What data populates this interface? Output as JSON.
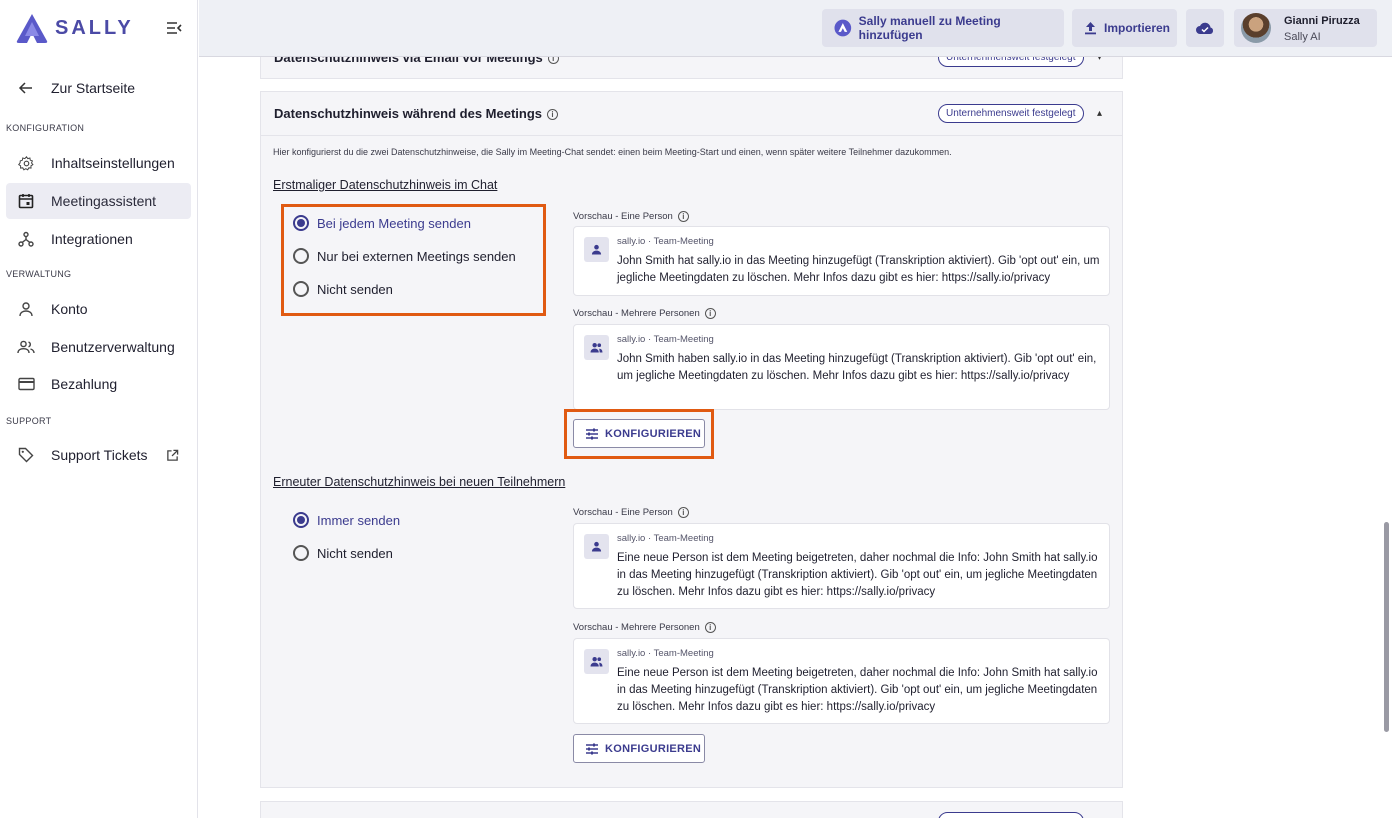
{
  "app": {
    "brand": "SALLY"
  },
  "sidebar": {
    "back_label": "Zur Startseite",
    "sections": {
      "config": "KONFIGURATION",
      "admin": "VERWALTUNG",
      "support": "SUPPORT"
    },
    "items": [
      {
        "label": "Inhaltseinstellungen",
        "icon": "gear-icon",
        "active": false
      },
      {
        "label": "Meetingassistent",
        "icon": "calendar-icon",
        "active": true
      },
      {
        "label": "Integrationen",
        "icon": "integration-icon",
        "active": false
      },
      {
        "label": "Konto",
        "icon": "person-icon",
        "active": false
      },
      {
        "label": "Benutzerverwaltung",
        "icon": "people-icon",
        "active": false
      },
      {
        "label": "Bezahlung",
        "icon": "credit-card-icon",
        "active": false
      },
      {
        "label": "Support Tickets",
        "icon": "tag-icon",
        "active": false
      }
    ]
  },
  "topbar": {
    "add_sally_label": "Sally manuell zu Meeting hinzufügen",
    "import_label": "Importieren",
    "user": {
      "name": "Gianni Piruzza",
      "role": "Sally AI"
    }
  },
  "main": {
    "panel_top": {
      "title": "Datenschutzhinweis via Email vor Meetings",
      "badge": "Unternehmensweit festgelegt"
    },
    "panel": {
      "title": "Datenschutzhinweis während des Meetings",
      "badge": "Unternehmensweit festgelegt",
      "description": "Hier konfigurierst du die zwei Datenschutzhinweise, die Sally im Meeting-Chat sendet: einen beim Meeting-Start und einen, wenn später weitere Teilnehmer dazukommen.",
      "first": {
        "title": "Erstmaliger Datenschutzhinweis im Chat",
        "options": [
          {
            "label": "Bei jedem Meeting senden",
            "selected": true
          },
          {
            "label": "Nur bei externen Meetings senden",
            "selected": false
          },
          {
            "label": "Nicht senden",
            "selected": false
          }
        ],
        "preview_single_label": "Vorschau - Eine Person",
        "preview_single": {
          "meta": "sally.io · Team-Meeting",
          "text": "John Smith hat sally.io in das Meeting hinzugefügt (Transkription aktiviert). Gib 'opt out' ein, um jegliche Meetingdaten zu löschen. Mehr Infos dazu gibt es hier: https://sally.io/privacy"
        },
        "preview_multi_label": "Vorschau - Mehrere Personen",
        "preview_multi": {
          "meta": "sally.io · Team-Meeting",
          "text": "John Smith haben sally.io in das Meeting hinzugefügt (Transkription aktiviert). Gib 'opt out' ein, um jegliche Meetingdaten zu löschen. Mehr Infos dazu gibt es hier: https://sally.io/privacy"
        },
        "configure_label": "KONFIGURIEREN"
      },
      "second": {
        "title": "Erneuter Datenschutzhinweis bei neuen Teilnehmern",
        "options": [
          {
            "label": "Immer senden",
            "selected": true
          },
          {
            "label": "Nicht senden",
            "selected": false
          }
        ],
        "preview_single_label": "Vorschau - Eine Person",
        "preview_single": {
          "meta": "sally.io · Team-Meeting",
          "text": "Eine neue Person ist dem Meeting beigetreten, daher nochmal die Info:  John Smith hat sally.io in das Meeting hinzugefügt (Transkription aktiviert). Gib 'opt out' ein, um jegliche Meetingdaten zu löschen. Mehr Infos dazu gibt es hier: https://sally.io/privacy"
        },
        "preview_multi_label": "Vorschau - Mehrere Personen",
        "preview_multi": {
          "meta": "sally.io · Team-Meeting",
          "text": "Eine neue Person ist dem Meeting beigetreten, daher nochmal die Info:  John Smith hat sally.io in das Meeting hinzugefügt (Transkription aktiviert). Gib 'opt out' ein, um jegliche Meetingdaten zu löschen. Mehr Infos dazu gibt es hier: https://sally.io/privacy"
        },
        "configure_label": "KONFIGURIEREN"
      }
    }
  },
  "colors": {
    "accent": "#3b3b8e",
    "highlight": "#e05a12"
  }
}
